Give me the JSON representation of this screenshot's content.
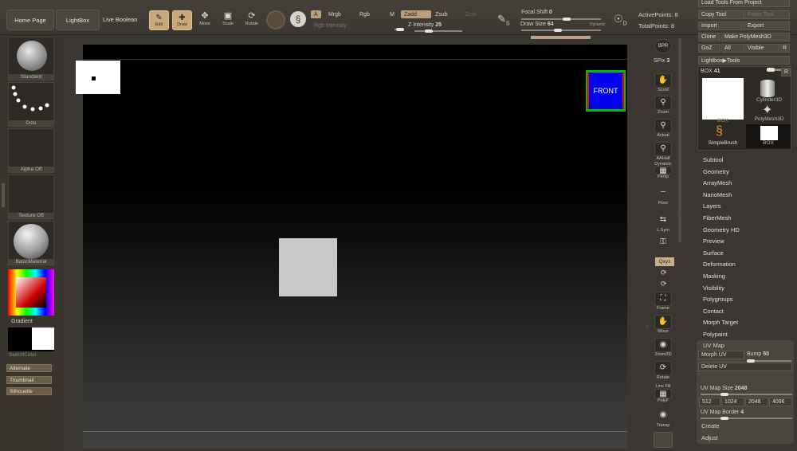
{
  "top": {
    "home": "Home Page",
    "lightbox": "LightBox",
    "live_boolean": "Live Boolean",
    "edit": "Edit",
    "draw": "Draw",
    "move": "Move",
    "scale": "Scale",
    "rotate": "Rotate",
    "a": "A",
    "mrgb": "Mrgb",
    "rgb": "Rgb",
    "m": "M",
    "zadd": "Zadd",
    "zsub": "Zsub",
    "zcut": "Zcut",
    "rgb_intensity": "Rgb Intensity",
    "z_intensity_label": "Z Intensity",
    "z_intensity_value": "25",
    "focal_shift_label": "Focal Shift",
    "focal_shift_value": "0",
    "draw_size_label": "Draw Size",
    "draw_size_value": "64",
    "dynamic": "Dynamic",
    "active_points_label": "ActivePoints:",
    "active_points_value": "8",
    "total_points_label": "TotalPoints:",
    "total_points_value": "8",
    "s_icon": "S",
    "d_icon": "D",
    "focal_shift_value_fraction": 0.58,
    "draw_size_value_fraction": 0.45,
    "z_intensity_value_fraction": 0.25
  },
  "left": {
    "standard": "Standard",
    "dots": "Dots",
    "alpha_off": "Alpha Off",
    "texture_off": "Texture Off",
    "material": "BasicMaterial",
    "gradient": "Gradient",
    "switch_color": "SwitchColor",
    "alternate": "Alternate",
    "thumbnail": "Thumbnail",
    "silhouette": "Silhouette"
  },
  "canvas": {
    "front_label": "FRONT"
  },
  "right": {
    "bpr": "BPR",
    "spix_label": "SPix",
    "spix_value": "3",
    "scroll": "Scroll",
    "zoom": "Zoom",
    "actual": "Actual",
    "aahalf": "AAHalf",
    "dynamic": "Dynamic",
    "persp": "Persp",
    "floor": "Floor",
    "lsym": "L.Sym",
    "xyz": "Qxyz",
    "frame": "Frame",
    "move": "Move",
    "zoom3d": "Zoom3D",
    "rotate": "Rotate",
    "linefill": "Line Fill",
    "polyf": "PolyF",
    "transp": "Transp"
  },
  "tool": {
    "load_tools": "Load Tools From Project",
    "copy_tool": "Copy Tool",
    "paste_tool": "Paste Tool",
    "import": "Import",
    "export": "Export",
    "clone": "Clone",
    "make_polymesh": "Make PolyMesh3D",
    "goz": "GoZ",
    "all": "All",
    "visible": "Visible",
    "r": "R",
    "lightbox_tools": "Lightbox▶Tools",
    "box_label": "BOX",
    "box_value": "41",
    "r2": "R",
    "box": "BOX",
    "cylinder": "Cylinder3D",
    "polymesh": "PolyMesh3D",
    "simplebrush": "SimpleBrush",
    "box2": "BOX",
    "menu": [
      "Subtool",
      "Geometry",
      "ArrayMesh",
      "NanoMesh",
      "Layers",
      "FiberMesh",
      "Geometry HD",
      "Preview",
      "Surface",
      "Deformation",
      "Masking",
      "Visibility",
      "Polygroups",
      "Contact",
      "Morph Target",
      "Polypaint"
    ],
    "uv_map": "UV Map",
    "morph_uv": "Morph UV",
    "bump_label": "Bump",
    "bump_value": "50",
    "delete_uv": "Delete UV",
    "uv_map_size_label": "UV Map Size",
    "uv_map_size_value": "2048",
    "sizes": [
      "512",
      "1024",
      "2048",
      "4096"
    ],
    "uv_map_border_label": "UV Map Border",
    "uv_map_border_value": "4",
    "create": "Create",
    "adjust": "Adjust"
  }
}
